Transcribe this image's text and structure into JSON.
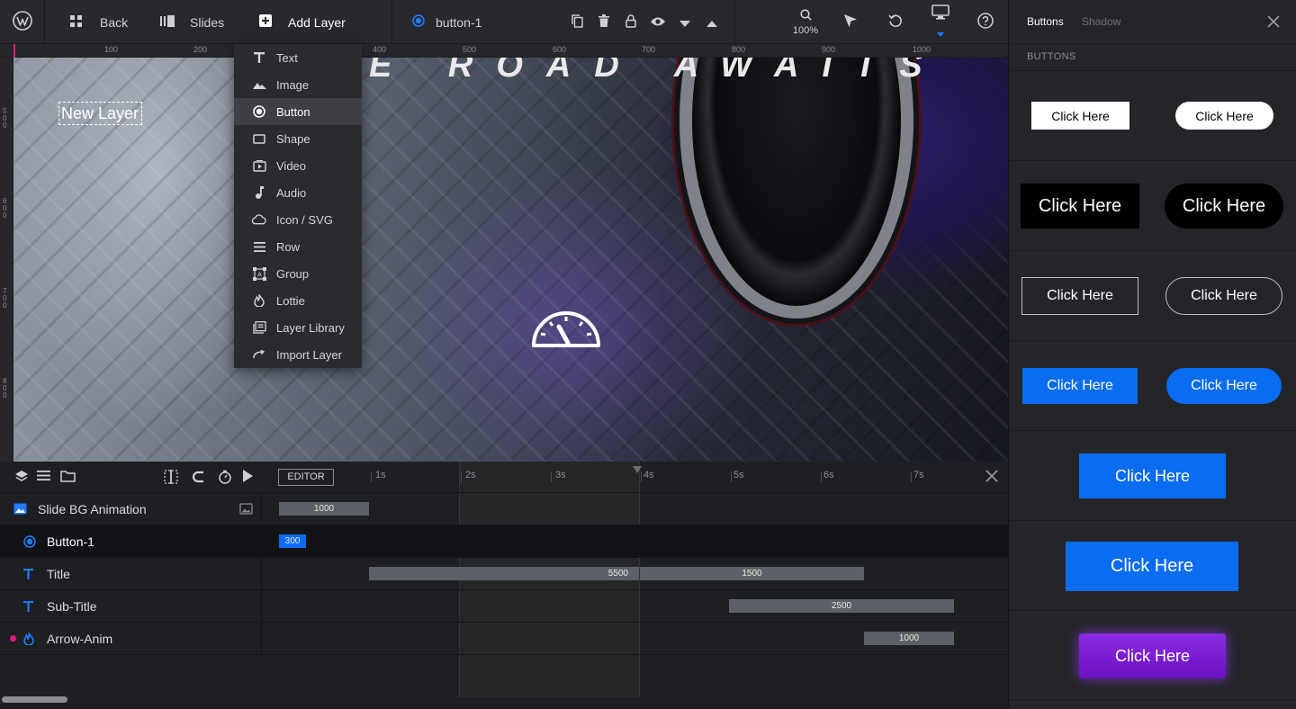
{
  "topbar": {
    "back_label": "Back",
    "slides_label": "Slides",
    "add_layer_label": "Add Layer",
    "layer_name": "button-1",
    "zoom": "100%"
  },
  "ruler": {
    "top_labels": [
      "100",
      "200",
      "400",
      "500",
      "600",
      "700",
      "800",
      "900",
      "1000"
    ],
    "left_labels": [
      "500",
      "600",
      "700",
      "800"
    ]
  },
  "canvas": {
    "headline": "E ROAD AWAITS",
    "new_layer_text": "New Layer"
  },
  "add_menu": {
    "items": [
      {
        "label": "Text",
        "icon": "text-icon"
      },
      {
        "label": "Image",
        "icon": "image-icon"
      },
      {
        "label": "Button",
        "icon": "button-icon"
      },
      {
        "label": "Shape",
        "icon": "shape-icon"
      },
      {
        "label": "Video",
        "icon": "video-icon"
      },
      {
        "label": "Audio",
        "icon": "audio-icon"
      },
      {
        "label": "Icon / SVG",
        "icon": "cloud-icon"
      },
      {
        "label": "Row",
        "icon": "row-icon"
      },
      {
        "label": "Group",
        "icon": "group-icon"
      },
      {
        "label": "Lottie",
        "icon": "lottie-icon"
      },
      {
        "label": "Layer Library",
        "icon": "library-icon"
      },
      {
        "label": "Import Layer",
        "icon": "import-icon"
      }
    ],
    "active_item": "Button"
  },
  "timeline": {
    "editor_label": "EDITOR",
    "seconds": [
      "1s",
      "2s",
      "3s",
      "4s",
      "5s",
      "6s",
      "7s"
    ],
    "rows": [
      {
        "label": "Slide BG Animation",
        "icon": "image-icon",
        "bars": [
          {
            "text": "1000"
          }
        ]
      },
      {
        "label": "Button-1",
        "icon": "button-icon",
        "bars": [
          {
            "text": "300"
          }
        ]
      },
      {
        "label": "Title",
        "icon": "text-icon",
        "bars": [
          {
            "text": "5500"
          },
          {
            "text": "1500"
          }
        ]
      },
      {
        "label": "Sub-Title",
        "icon": "text-icon",
        "bars": [
          {
            "text": "2500"
          }
        ]
      },
      {
        "label": "Arrow-Anim",
        "icon": "lottie-icon",
        "bars": [
          {
            "text": "1000"
          }
        ]
      }
    ]
  },
  "right_panel": {
    "tab_buttons": "Buttons",
    "tab_shadow": "Shadow",
    "section_title": "BUTTONS",
    "preset_label": "Click Here",
    "colors": {
      "blue": "#0a6cf0",
      "purple": "#7b1fd0",
      "black": "#000000",
      "white": "#ffffff"
    }
  }
}
